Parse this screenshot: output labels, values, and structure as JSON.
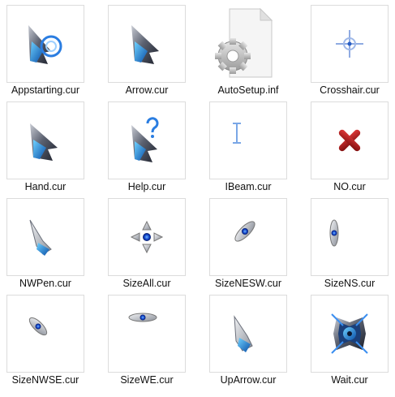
{
  "files": [
    {
      "name": "Appstarting.cur",
      "icon": "appstarting-cursor-icon"
    },
    {
      "name": "Arrow.cur",
      "icon": "arrow-cursor-icon"
    },
    {
      "name": "AutoSetup.inf",
      "icon": "settings-file-icon"
    },
    {
      "name": "Crosshair.cur",
      "icon": "crosshair-cursor-icon"
    },
    {
      "name": "Hand.cur",
      "icon": "hand-cursor-icon"
    },
    {
      "name": "Help.cur",
      "icon": "help-cursor-icon"
    },
    {
      "name": "IBeam.cur",
      "icon": "ibeam-cursor-icon"
    },
    {
      "name": "NO.cur",
      "icon": "no-cursor-icon"
    },
    {
      "name": "NWPen.cur",
      "icon": "pen-cursor-icon"
    },
    {
      "name": "SizeAll.cur",
      "icon": "sizeall-cursor-icon"
    },
    {
      "name": "SizeNESW.cur",
      "icon": "sizenesw-cursor-icon"
    },
    {
      "name": "SizeNS.cur",
      "icon": "sizens-cursor-icon"
    },
    {
      "name": "SizeNWSE.cur",
      "icon": "sizenwse-cursor-icon"
    },
    {
      "name": "SizeWE.cur",
      "icon": "sizewe-cursor-icon"
    },
    {
      "name": "UpArrow.cur",
      "icon": "uparrow-cursor-icon"
    },
    {
      "name": "Wait.cur",
      "icon": "wait-cursor-icon"
    }
  ]
}
